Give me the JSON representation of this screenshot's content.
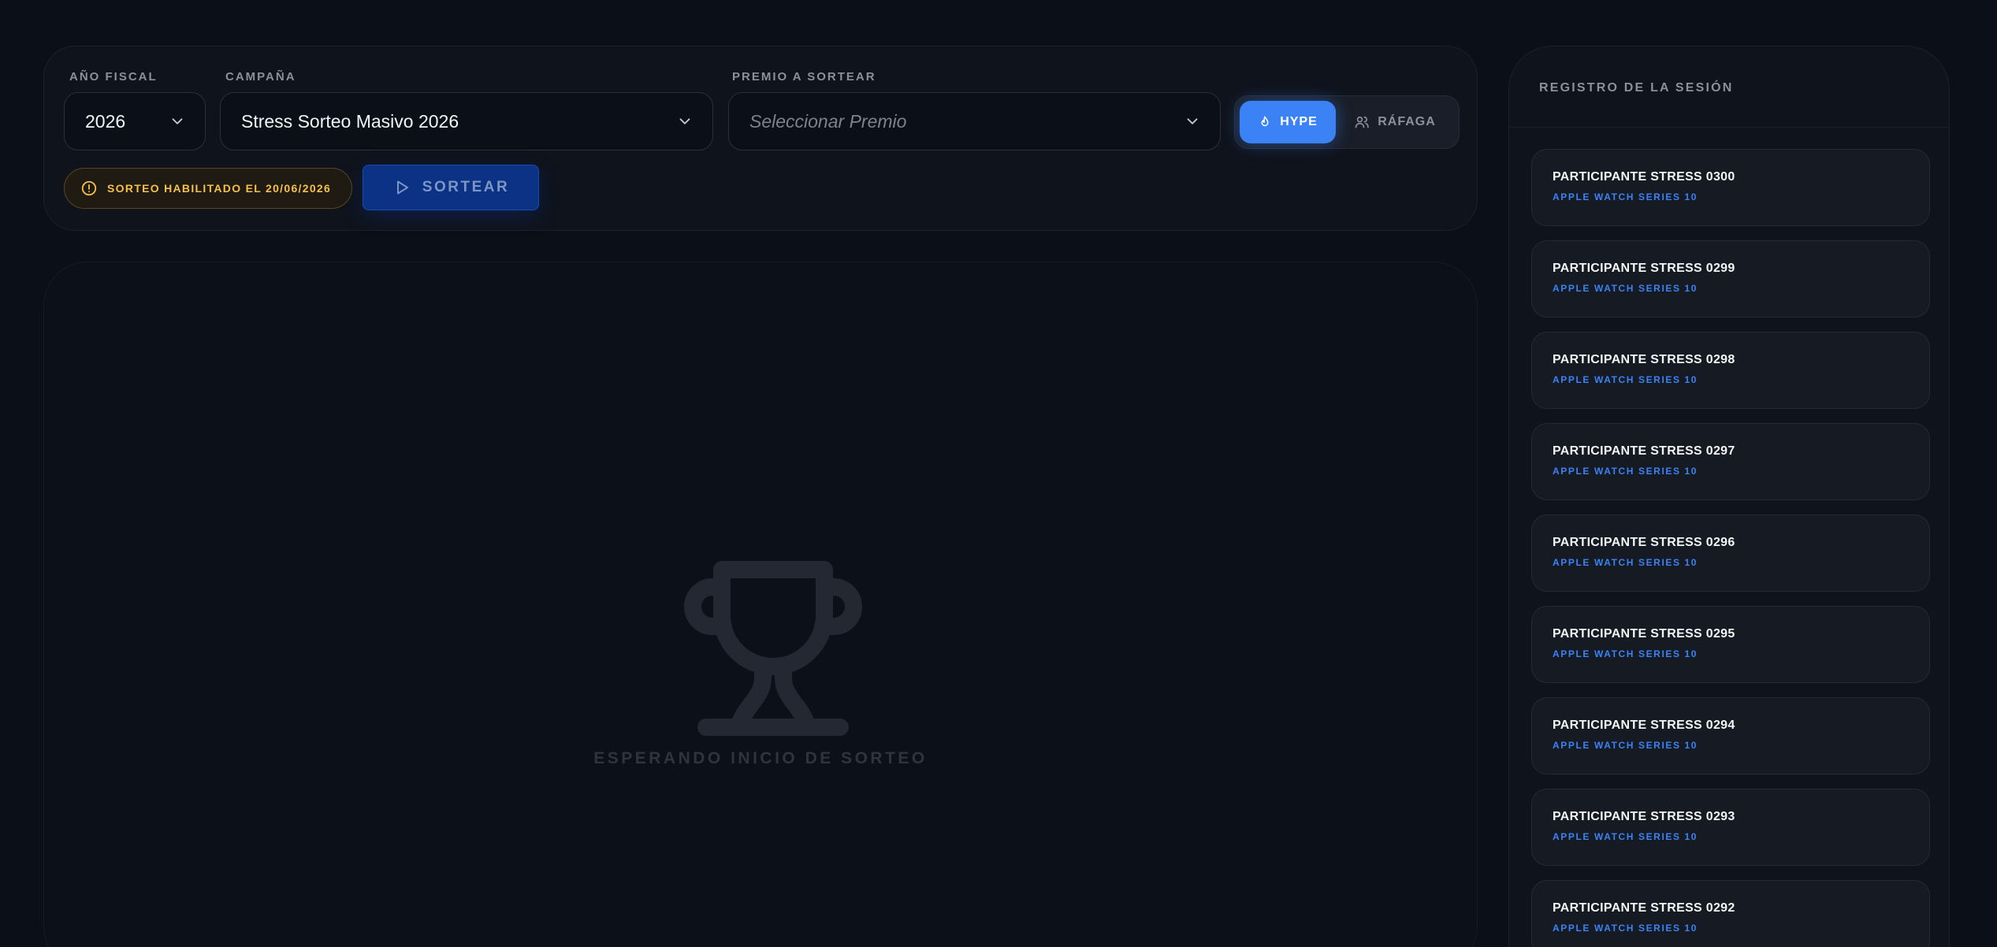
{
  "filters": {
    "year": {
      "label": "AÑO FISCAL",
      "value": "2026"
    },
    "campaign": {
      "label": "CAMPAÑA",
      "value": "Stress Sorteo Masivo 2026"
    },
    "prize": {
      "label": "PREMIO A SORTEAR",
      "placeholder": "Seleccionar Premio"
    }
  },
  "mode": {
    "hype": {
      "label": "HYPE",
      "icon": "flame-icon",
      "active": true
    },
    "rafaga": {
      "label": "RÁFAGA",
      "icon": "users-icon",
      "active": false
    }
  },
  "notice": {
    "text": "SORTEO HABILITADO EL 20/06/2026",
    "icon": "alert-circle-icon"
  },
  "draw_button": {
    "label": "SORTEAR",
    "icon": "play-icon"
  },
  "stage": {
    "status": "ESPERANDO INICIO DE SORTEO",
    "icon": "trophy-icon"
  },
  "log": {
    "title": "REGISTRO DE LA SESIÓN",
    "items": [
      {
        "name": "PARTICIPANTE STRESS 0300",
        "prize": "APPLE WATCH SERIES 10"
      },
      {
        "name": "PARTICIPANTE STRESS 0299",
        "prize": "APPLE WATCH SERIES 10"
      },
      {
        "name": "PARTICIPANTE STRESS 0298",
        "prize": "APPLE WATCH SERIES 10"
      },
      {
        "name": "PARTICIPANTE STRESS 0297",
        "prize": "APPLE WATCH SERIES 10"
      },
      {
        "name": "PARTICIPANTE STRESS 0296",
        "prize": "APPLE WATCH SERIES 10"
      },
      {
        "name": "PARTICIPANTE STRESS 0295",
        "prize": "APPLE WATCH SERIES 10"
      },
      {
        "name": "PARTICIPANTE STRESS 0294",
        "prize": "APPLE WATCH SERIES 10"
      },
      {
        "name": "PARTICIPANTE STRESS 0293",
        "prize": "APPLE WATCH SERIES 10"
      },
      {
        "name": "PARTICIPANTE STRESS 0292",
        "prize": "APPLE WATCH SERIES 10"
      }
    ]
  },
  "colors": {
    "background": "#0b0f17",
    "accent": "#3b82f6",
    "warning": "#f5c04a",
    "button": "#0b3285"
  }
}
